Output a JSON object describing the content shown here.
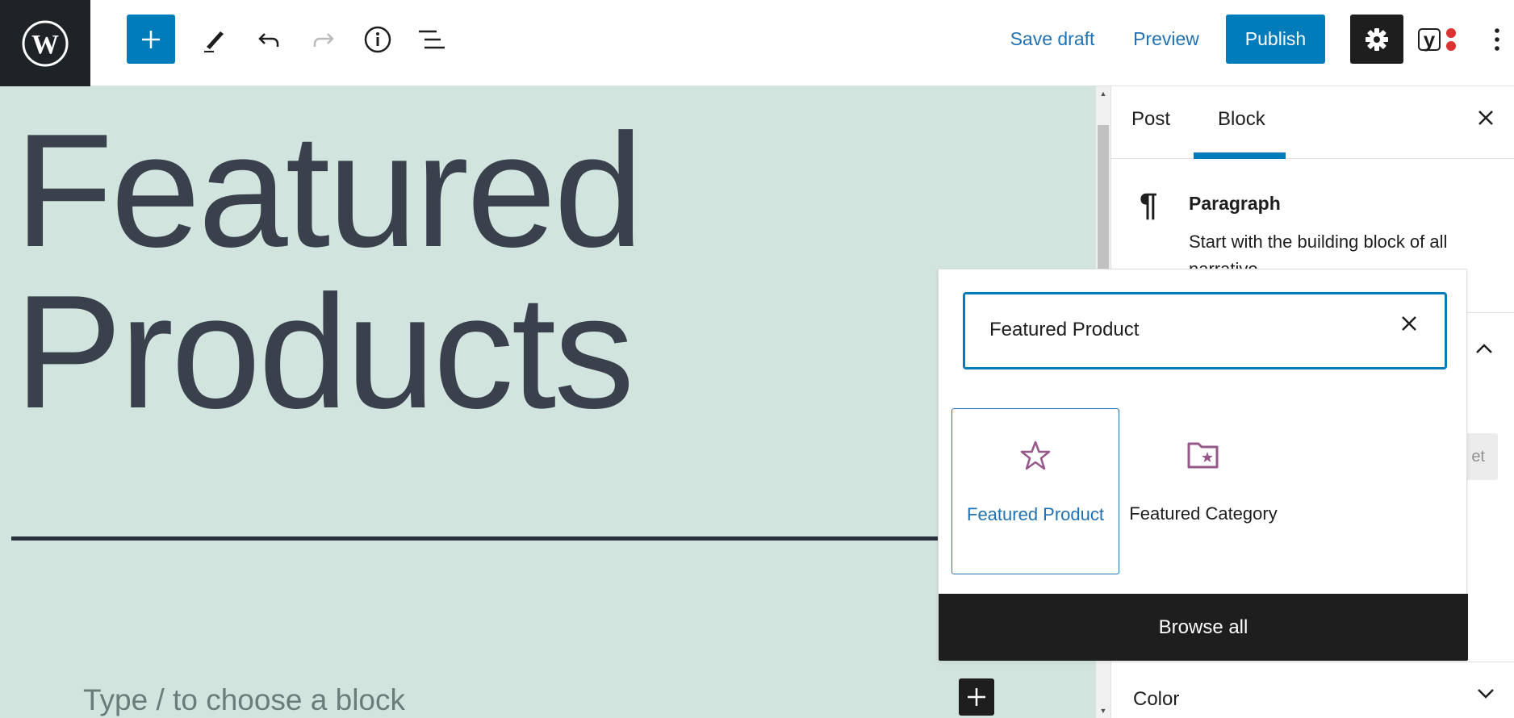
{
  "toolbar": {
    "logo": "wordpress-logo",
    "save_draft": "Save draft",
    "preview": "Preview",
    "publish": "Publish"
  },
  "canvas": {
    "heading_line1": "Featured",
    "heading_line2": "Products",
    "block_placeholder": "Type / to choose a block"
  },
  "sidebar": {
    "tabs": [
      {
        "label": "Post",
        "active": false
      },
      {
        "label": "Block",
        "active": true
      }
    ],
    "block_card": {
      "title": "Paragraph",
      "description": "Start with the building block of all narrative."
    },
    "partial_button_visible_text": "et",
    "color_panel_label": "Color"
  },
  "quick_inserter": {
    "search_value": "Featured Product",
    "results": [
      {
        "label": "Featured Product",
        "icon": "star-icon",
        "selected": true
      },
      {
        "label": "Featured Category",
        "icon": "folder-star-icon",
        "selected": false
      }
    ],
    "browse_all": "Browse all"
  },
  "colors": {
    "accent": "#007cba",
    "canvas_bg": "#d1e4de",
    "heading_text": "#3a414d",
    "block_icon": "#96588a",
    "dark": "#1e1e1e"
  }
}
